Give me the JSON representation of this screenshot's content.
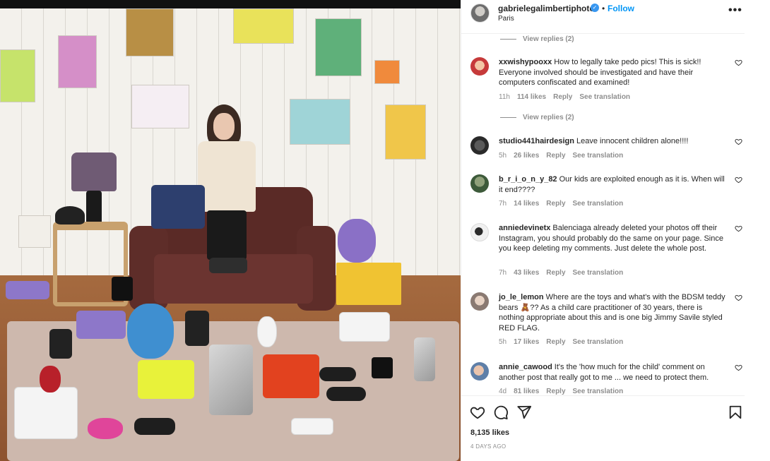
{
  "header": {
    "username": "gabrielegalimbertiphoto",
    "verified_icon": "verified-badge-icon",
    "separator": "•",
    "follow_label": "Follow",
    "location": "Paris",
    "more_icon": "more-options-icon",
    "more_glyph": "•••"
  },
  "comments": {
    "replies_top": {
      "label": "View replies (2)"
    },
    "replies_mid": {
      "label": "View replies (2)"
    },
    "items": [
      {
        "username": "xxwishypooxx",
        "text": "How to legally take pedo pics! This is sick!! Everyone involved should be investigated and have their computers confiscated and examined!",
        "time": "11h",
        "likes": "114 likes",
        "reply": "Reply",
        "translate": "See translation"
      },
      {
        "username": "studio441hairdesign",
        "text": "Leave innocent children alone!!!!",
        "time": "5h",
        "likes": "26 likes",
        "reply": "Reply",
        "translate": "See translation"
      },
      {
        "username": "b_r_i_o_n_y_82",
        "text": "Our kids are exploited enough as it is. When will it end????",
        "time": "7h",
        "likes": "14 likes",
        "reply": "Reply",
        "translate": "See translation"
      },
      {
        "username": "anniedevinetx",
        "text": "Balenciaga already deleted your photos off their Instagram, you should probably do the same on your page. Since you keep deleting my comments. Just delete the whole post.",
        "time": "7h",
        "likes": "43 likes",
        "reply": "Reply",
        "translate": "See translation"
      },
      {
        "username": "jo_le_lemon",
        "text": "Where are the toys and what's with the BDSM teddy bears 🧸?? As a child care practitioner of 30 years, there is nothing appropriate about this and is one big Jimmy Savile styled RED FLAG.",
        "time": "5h",
        "likes": "17 likes",
        "reply": "Reply",
        "translate": "See translation"
      },
      {
        "username": "annie_cawood",
        "text": "It's the 'how much for the child' comment on another post that really got to me ... we need to protect them.",
        "time": "4d",
        "likes": "81 likes",
        "reply": "Reply",
        "translate": "See translation"
      }
    ]
  },
  "actions": {
    "like_icon": "heart-icon",
    "comment_icon": "comment-bubble-icon",
    "share_icon": "paper-plane-icon",
    "save_icon": "bookmark-icon",
    "likes_count": "8,135 likes",
    "posted": "4 DAYS AGO"
  },
  "colors": {
    "link_blue": "#0095f6",
    "verified_blue": "#3897f0",
    "muted_text": "#8e8e8e",
    "text": "#262626"
  }
}
